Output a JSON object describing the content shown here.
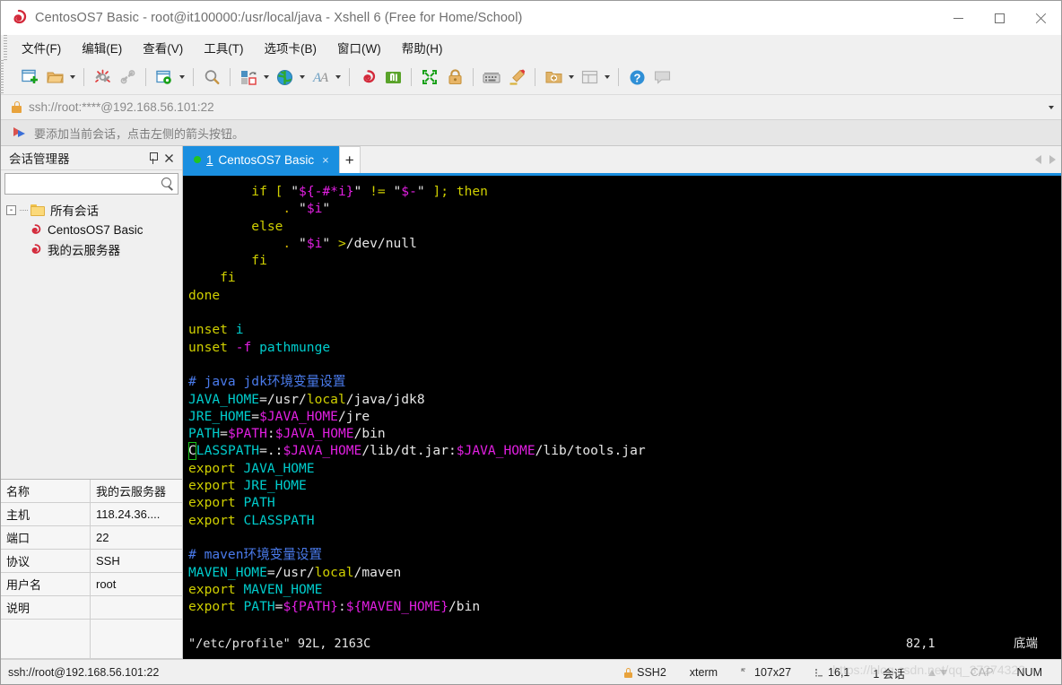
{
  "window": {
    "title": "CentosOS7 Basic - root@it100000:/usr/local/java - Xshell 6 (Free for Home/School)",
    "app_icon": "xshell-logo-icon",
    "minimize_label": "Minimize",
    "maximize_label": "Maximize",
    "close_label": "Close"
  },
  "menu": {
    "items": [
      {
        "label": "文件(F)",
        "name": "menu-file"
      },
      {
        "label": "编辑(E)",
        "name": "menu-edit"
      },
      {
        "label": "查看(V)",
        "name": "menu-view"
      },
      {
        "label": "工具(T)",
        "name": "menu-tools"
      },
      {
        "label": "选项卡(B)",
        "name": "menu-tabs"
      },
      {
        "label": "窗口(W)",
        "name": "menu-window"
      },
      {
        "label": "帮助(H)",
        "name": "menu-help"
      }
    ]
  },
  "toolbar": {
    "items": [
      {
        "name": "new-session-icon",
        "caret": false
      },
      {
        "name": "open-folder-icon",
        "caret": true
      },
      {
        "sep": true
      },
      {
        "name": "disconnect-icon",
        "caret": false
      },
      {
        "name": "reconnect-icon",
        "caret": false
      },
      {
        "sep": true
      },
      {
        "name": "session-properties-icon",
        "caret": true
      },
      {
        "sep": true
      },
      {
        "name": "find-icon",
        "caret": false
      },
      {
        "sep": true
      },
      {
        "name": "layout-icon",
        "caret": true
      },
      {
        "name": "globe-encoding-icon",
        "caret": true
      },
      {
        "name": "font-icon",
        "caret": true
      },
      {
        "sep": true
      },
      {
        "name": "xshell-icon",
        "caret": false
      },
      {
        "name": "xftp-icon",
        "caret": false
      },
      {
        "sep": true
      },
      {
        "name": "fullscreen-icon",
        "caret": false
      },
      {
        "name": "lock-icon",
        "caret": false
      },
      {
        "sep": true
      },
      {
        "name": "keyboard-icon",
        "caret": false
      },
      {
        "name": "highlight-icon",
        "caret": false
      },
      {
        "sep": true
      },
      {
        "name": "new-folder-icon",
        "caret": true
      },
      {
        "name": "panes-icon",
        "caret": true
      },
      {
        "sep": true
      },
      {
        "name": "help-icon",
        "caret": false
      },
      {
        "name": "feedback-icon",
        "caret": false
      }
    ]
  },
  "address": {
    "lock_icon": "lock-icon",
    "value": "ssh://root:****@192.168.56.101:22",
    "dropdown_icon": "chevron-down-icon"
  },
  "notice": {
    "icon": "flag-icon",
    "text": "要添加当前会话，点击左侧的箭头按钮。"
  },
  "sidebar": {
    "title": "会话管理器",
    "pin_icon": "pin-icon",
    "close_icon": "close-icon",
    "search_placeholder": "",
    "search_icon": "search-icon",
    "tree": {
      "root": {
        "label": "所有会话",
        "icon": "folder-icon",
        "expander": "-"
      },
      "children": [
        {
          "label": "CentosOS7 Basic",
          "icon": "xshell-session-icon",
          "selected": false
        },
        {
          "label": "我的云服务器",
          "icon": "xshell-session-icon",
          "selected": true
        }
      ]
    },
    "properties": [
      {
        "key": "名称",
        "value": "我的云服务器"
      },
      {
        "key": "主机",
        "value": "118.24.36...."
      },
      {
        "key": "端口",
        "value": "22"
      },
      {
        "key": "协议",
        "value": "SSH"
      },
      {
        "key": "用户名",
        "value": "root"
      },
      {
        "key": "说明",
        "value": ""
      }
    ]
  },
  "tabs": {
    "active": {
      "index": "1",
      "label": "CentosOS7 Basic",
      "status_dot_color": "#21c421",
      "close_label": "×"
    },
    "add_label": "+",
    "nav_prev_icon": "chevron-left-icon",
    "nav_next_icon": "chevron-right-icon"
  },
  "terminal": {
    "lines": [
      [
        {
          "t": "        if [ ",
          "c": "yellow"
        },
        {
          "t": "\"",
          "c": "white"
        },
        {
          "t": "${-#*i}",
          "c": "magenta"
        },
        {
          "t": "\"",
          "c": "white"
        },
        {
          "t": " != ",
          "c": "yellow"
        },
        {
          "t": "\"",
          "c": "white"
        },
        {
          "t": "$-",
          "c": "magenta"
        },
        {
          "t": "\"",
          "c": "white"
        },
        {
          "t": " ]; ",
          "c": "yellow"
        },
        {
          "t": "then",
          "c": "yellow"
        }
      ],
      [
        {
          "t": "            . ",
          "c": "orange"
        },
        {
          "t": "\"",
          "c": "white"
        },
        {
          "t": "$i",
          "c": "magenta"
        },
        {
          "t": "\"",
          "c": "white"
        }
      ],
      [
        {
          "t": "        else",
          "c": "yellow"
        }
      ],
      [
        {
          "t": "            . ",
          "c": "orange"
        },
        {
          "t": "\"",
          "c": "white"
        },
        {
          "t": "$i",
          "c": "magenta"
        },
        {
          "t": "\"",
          "c": "white"
        },
        {
          "t": " ",
          "c": "white"
        },
        {
          "t": ">",
          "c": "yellow"
        },
        {
          "t": "/dev/null",
          "c": "white"
        }
      ],
      [
        {
          "t": "        fi",
          "c": "yellow"
        }
      ],
      [
        {
          "t": "    fi",
          "c": "yellow"
        }
      ],
      [
        {
          "t": "done",
          "c": "yellow"
        }
      ],
      [],
      [
        {
          "t": "unset ",
          "c": "yellow"
        },
        {
          "t": "i",
          "c": "cyan"
        }
      ],
      [
        {
          "t": "unset ",
          "c": "yellow"
        },
        {
          "t": "-f",
          "c": "magenta"
        },
        {
          "t": " ",
          "c": "white"
        },
        {
          "t": "pathmunge",
          "c": "cyan"
        }
      ],
      [],
      [
        {
          "t": "# java jdk环境变量设置",
          "c": "blue"
        }
      ],
      [
        {
          "t": "JAVA_HOME",
          "c": "cyan"
        },
        {
          "t": "=",
          "c": "white"
        },
        {
          "t": "/usr/",
          "c": "white"
        },
        {
          "t": "local",
          "c": "yellow"
        },
        {
          "t": "/java/jdk8",
          "c": "white"
        }
      ],
      [
        {
          "t": "JRE_HOME",
          "c": "cyan"
        },
        {
          "t": "=",
          "c": "white"
        },
        {
          "t": "$JAVA_HOME",
          "c": "magenta"
        },
        {
          "t": "/jre",
          "c": "white"
        }
      ],
      [
        {
          "t": "PATH",
          "c": "cyan"
        },
        {
          "t": "=",
          "c": "white"
        },
        {
          "t": "$PATH",
          "c": "magenta"
        },
        {
          "t": ":",
          "c": "white"
        },
        {
          "t": "$JAVA_HOME",
          "c": "magenta"
        },
        {
          "t": "/bin",
          "c": "white"
        }
      ],
      [
        {
          "t": "C",
          "c": "cursor"
        },
        {
          "t": "LASSPATH",
          "c": "cyan"
        },
        {
          "t": "=.:",
          "c": "white"
        },
        {
          "t": "$JAVA_HOME",
          "c": "magenta"
        },
        {
          "t": "/lib/dt.jar:",
          "c": "white"
        },
        {
          "t": "$JAVA_HOME",
          "c": "magenta"
        },
        {
          "t": "/lib/tools.jar",
          "c": "white"
        }
      ],
      [
        {
          "t": "export ",
          "c": "yellow"
        },
        {
          "t": "JAVA_HOME",
          "c": "cyan"
        }
      ],
      [
        {
          "t": "export ",
          "c": "yellow"
        },
        {
          "t": "JRE_HOME",
          "c": "cyan"
        }
      ],
      [
        {
          "t": "export ",
          "c": "yellow"
        },
        {
          "t": "PATH",
          "c": "cyan"
        }
      ],
      [
        {
          "t": "export ",
          "c": "yellow"
        },
        {
          "t": "CLASSPATH",
          "c": "cyan"
        }
      ],
      [],
      [
        {
          "t": "# maven环境变量设置",
          "c": "blue"
        }
      ],
      [
        {
          "t": "MAVEN_HOME",
          "c": "cyan"
        },
        {
          "t": "=",
          "c": "white"
        },
        {
          "t": "/usr/",
          "c": "white"
        },
        {
          "t": "local",
          "c": "yellow"
        },
        {
          "t": "/maven",
          "c": "white"
        }
      ],
      [
        {
          "t": "export ",
          "c": "yellow"
        },
        {
          "t": "MAVEN_HOME",
          "c": "cyan"
        }
      ],
      [
        {
          "t": "export ",
          "c": "yellow"
        },
        {
          "t": "PATH",
          "c": "cyan"
        },
        {
          "t": "=",
          "c": "white"
        },
        {
          "t": "${PATH}",
          "c": "magenta"
        },
        {
          "t": ":",
          "c": "white"
        },
        {
          "t": "${MAVEN_HOME}",
          "c": "magenta"
        },
        {
          "t": "/bin",
          "c": "white"
        }
      ]
    ],
    "vim_status": {
      "file": "\"/etc/profile\" 92L, 2163C",
      "position": "82,1",
      "scroll": "底端"
    }
  },
  "statusbar": {
    "connection": "ssh://root@192.168.56.101:22",
    "cells": [
      {
        "name": "status-protocol",
        "icon": "lock-icon",
        "text": "SSH2"
      },
      {
        "name": "status-terminal-type",
        "icon": "",
        "text": "xterm"
      },
      {
        "name": "status-size",
        "icon": "size-icon",
        "text": "107x27"
      },
      {
        "name": "status-cursor",
        "icon": "cursor-icon",
        "text": "16,1"
      },
      {
        "name": "status-sessions",
        "icon": "",
        "text": "1 会话"
      }
    ],
    "transfer_up_icon": "arrow-up-icon",
    "transfer_down_icon": "arrow-down-icon",
    "cap": "CAP",
    "num": "NUM"
  },
  "watermark": {
    "text": "https://blog.csdn.net/qq_37274323"
  },
  "colors": {
    "accent": "#1a8fe0",
    "terminal_bg": "#000000",
    "chrome": "#f0f0f0",
    "cursor_green": "#19c219",
    "lock_orange": "#e8a33d"
  }
}
